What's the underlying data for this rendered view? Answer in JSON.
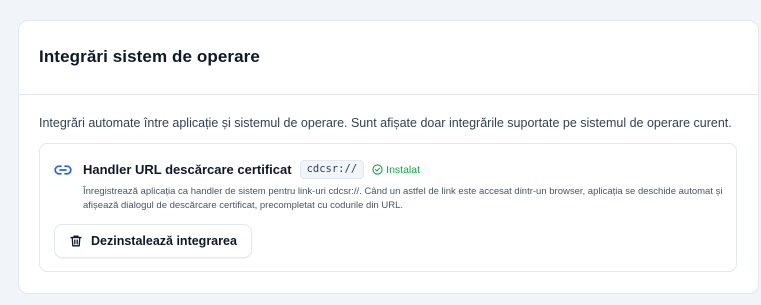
{
  "section": {
    "title": "Integrări sistem de operare",
    "description": "Integrări automate între aplicație și sistemul de operare. Sunt afișate doar integrările suportate pe sistemul de operare curent."
  },
  "integration": {
    "icon": "link-icon",
    "title": "Handler URL descărcare certificat",
    "protocol": "cdcsr://",
    "status_label": "Instalat",
    "status_icon": "check-circle-icon",
    "description": "Înregistrează aplicația ca handler de sistem pentru link-uri cdcsr://. Când un astfel de link este accesat dintr-un browser, aplicația se deschide automat și afișează dialogul de descărcare certificat, precompletat cu codurile din URL.",
    "uninstall_label": "Dezinstalează integrarea",
    "uninstall_icon": "trash-icon"
  },
  "colors": {
    "accent": "#2563eb",
    "success": "#16a34a",
    "border": "#e2e8f0",
    "background": "#f1f5f9"
  }
}
